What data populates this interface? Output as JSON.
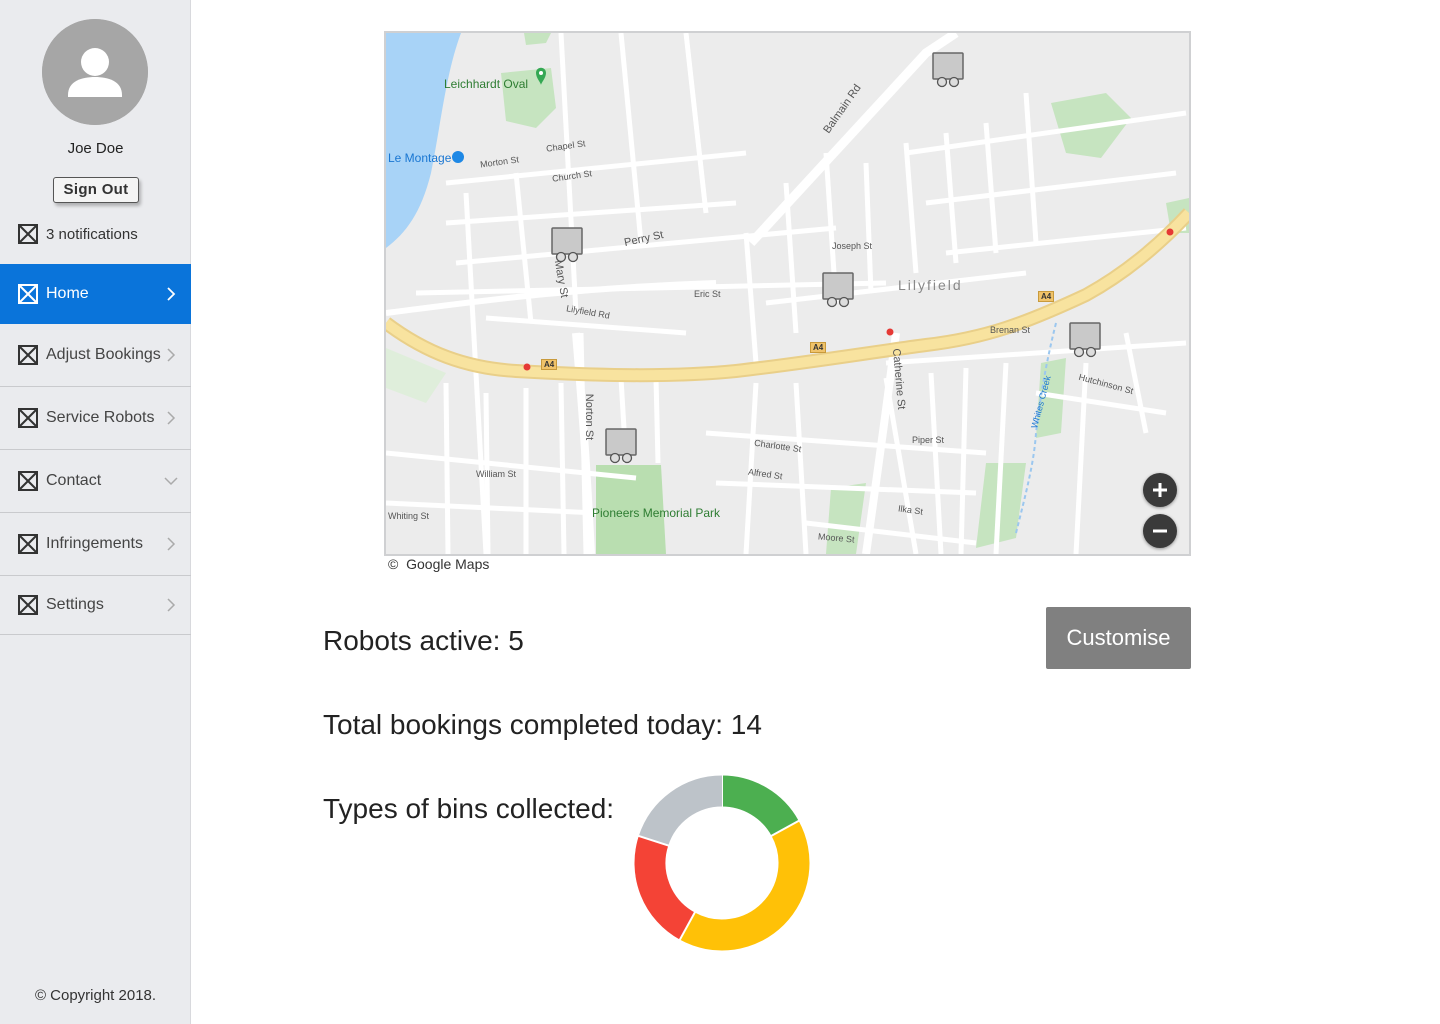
{
  "user": {
    "name": "Joe Doe",
    "sign_out_label": "Sign Out"
  },
  "notifications": {
    "label": "3 notifications"
  },
  "nav": {
    "items": [
      {
        "label": "Home",
        "active": true,
        "chevron": "chevron-right-icon"
      },
      {
        "label": "Adjust Bookings",
        "active": false,
        "chevron": "chevron-right-icon"
      },
      {
        "label": "Service Robots",
        "active": false,
        "chevron": "chevron-right-icon"
      },
      {
        "label": "Contact",
        "active": false,
        "chevron": "chevron-down-icon"
      },
      {
        "label": "Infringements",
        "active": false,
        "chevron": "chevron-right-icon"
      },
      {
        "label": "Settings",
        "active": false,
        "chevron": "chevron-right-icon"
      }
    ]
  },
  "footer": {
    "copyright": "© Copyright 2018."
  },
  "map": {
    "credit_symbol": "©",
    "credit": "Google Maps",
    "labels": {
      "leichhardt_oval": "Leichhardt Oval",
      "le_montage": "Le Montage",
      "lilyfield": "Lilyfield",
      "pioneers_park": "Pioneers Memorial Park",
      "whites_creek": "Whites Creek",
      "perry_st": "Perry St",
      "balmain_rd": "Balmain Rd",
      "norton_st": "Norton St",
      "catherine_st": "Catherine St",
      "mary_st": "Mary St",
      "brenan_st": "Brenan St",
      "william_st": "William St",
      "piper_st": "Piper St",
      "eric_st": "Eric St",
      "joseph_st": "Joseph St",
      "lilyfield_rd": "Lilyfield Rd",
      "church_st": "Church St",
      "chapel_st": "Chapel St",
      "morton_st": "Morton St",
      "hutchinson_st": "Hutchinson St",
      "charlotte_st": "Charlotte St",
      "alfred_st": "Alfred St",
      "moore_st": "Moore St",
      "ilka_st": "Ilka St",
      "whiting_st": "Whiting St"
    },
    "road_shield": "A4",
    "robots_on_map": 5,
    "zoom_in": "+",
    "zoom_out": "−"
  },
  "stats": {
    "robots_active": "Robots active: 5",
    "bookings_completed": "Total bookings completed today: 14",
    "bin_types_label": "Types of bins collected:"
  },
  "customise_button": "Customise",
  "chart_data": {
    "type": "pie",
    "donut": true,
    "slices": [
      {
        "value": 17,
        "color": "#4caf50"
      },
      {
        "value": 41,
        "color": "#ffc107"
      },
      {
        "value": 22,
        "color": "#f44336"
      },
      {
        "value": 20,
        "color": "#bdc3c9"
      }
    ]
  }
}
